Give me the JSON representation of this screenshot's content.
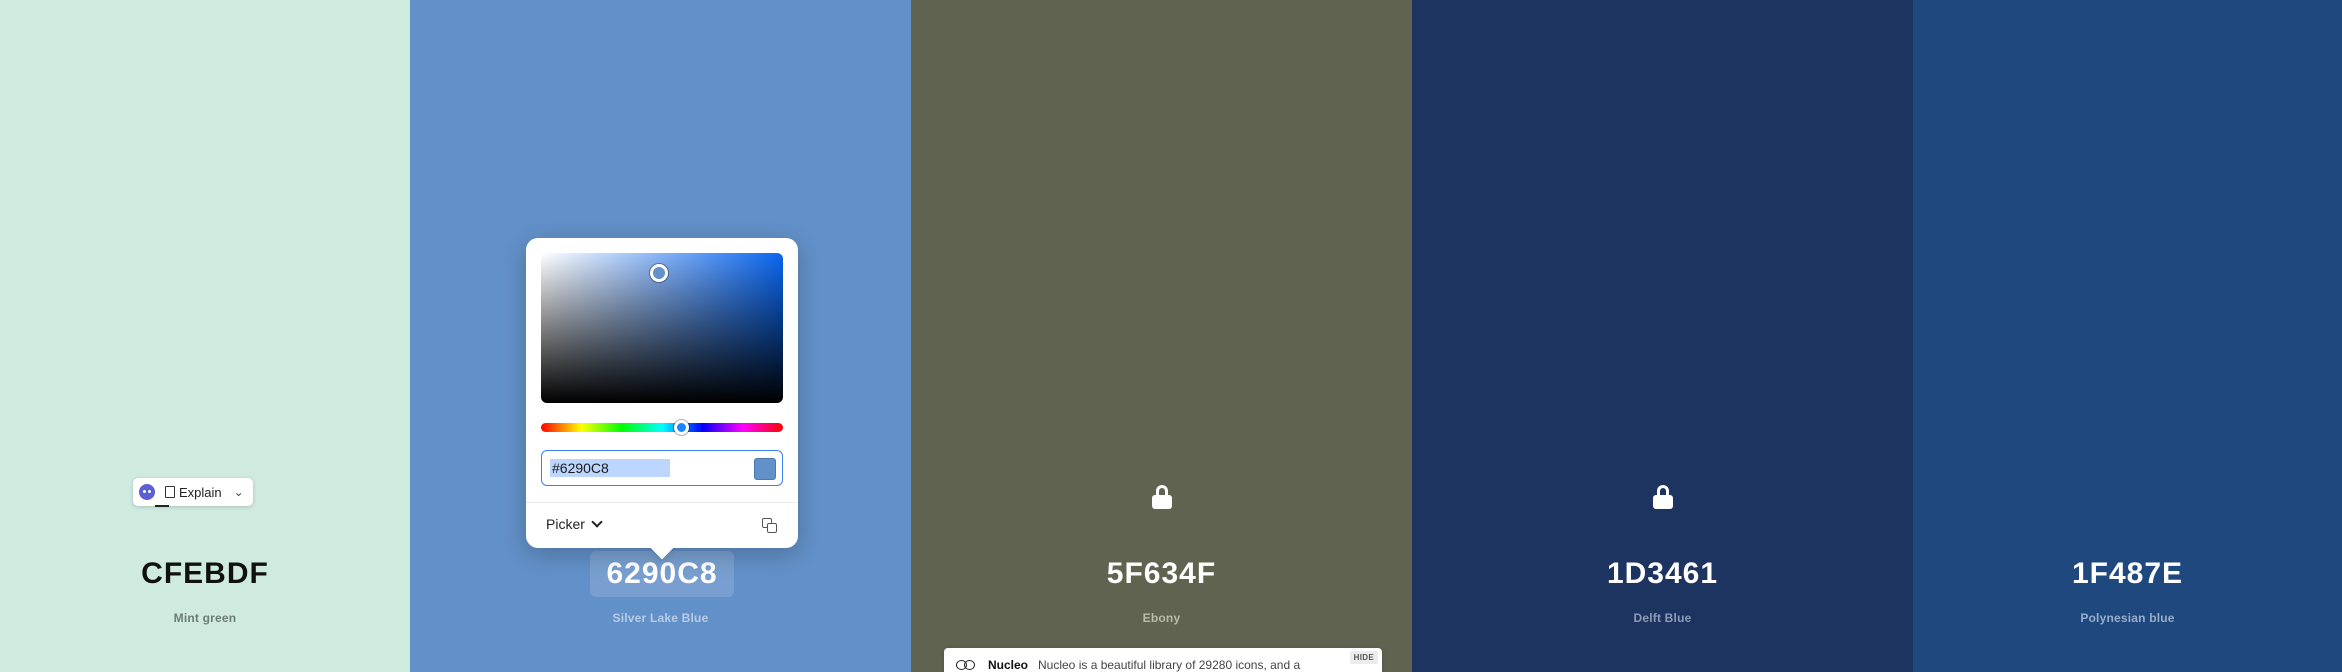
{
  "swatches": [
    {
      "hex": "CFEBDF",
      "name": "Mint green",
      "bg": "#CFEBDF",
      "text_color": "#111111",
      "name_color": "#6b7c74",
      "locked": false
    },
    {
      "hex": "6290C8",
      "name": "Silver Lake Blue",
      "bg": "#6290C8",
      "text_color": "#ffffff",
      "name_color": "#b7cce6",
      "locked": false
    },
    {
      "hex": "5F634F",
      "name": "Ebony",
      "bg": "#5F634F",
      "text_color": "#ffffff",
      "name_color": "#b9bcaa",
      "locked": true
    },
    {
      "hex": "1D3461",
      "name": "Delft Blue",
      "bg": "#1D3461",
      "text_color": "#ffffff",
      "name_color": "#8e9bb6",
      "locked": true
    },
    {
      "hex": "1F487E",
      "name": "Polynesian blue",
      "bg": "#1F487E",
      "text_color": "#ffffff",
      "name_color": "#98aecb",
      "locked": false
    }
  ],
  "explain_toolbar": {
    "label": "Explain",
    "icons": [
      "ghost-icon",
      "book-icon",
      "chevron-down-icon"
    ]
  },
  "color_picker": {
    "hex_value": "#6290C8",
    "mode": "Picker",
    "icons": [
      "copy-icon"
    ]
  },
  "ad": {
    "brand": "Nucleo",
    "text": "Nucleo is a beautiful library of 29280 icons, and a",
    "hide_label": "HIDE"
  }
}
